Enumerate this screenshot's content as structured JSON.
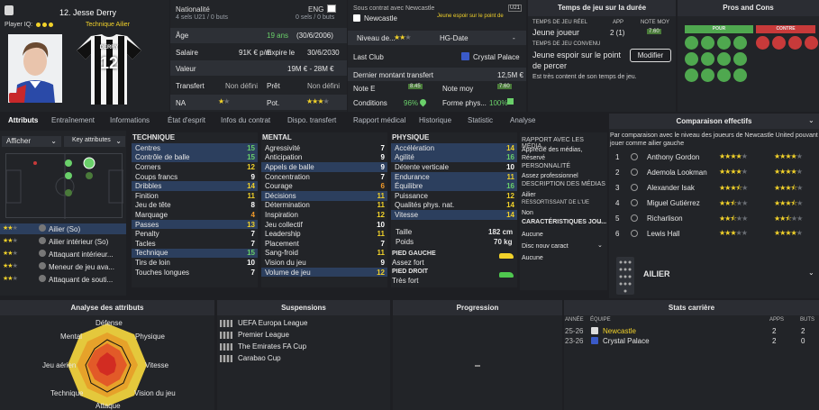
{
  "player": {
    "number_name": "12. Jesse Derry",
    "role_label": "Technique Ailier",
    "iq_label": "Player IQ:",
    "shirt_name": "DERRY",
    "shirt_number": "12"
  },
  "info": {
    "nationality_label": "Nationalité",
    "nationality_value": "ENG",
    "caps": "4 sels U21 / 0 buts",
    "caps2": "0 sels / 0 buts",
    "age_label": "Âge",
    "age_value": "19 ans",
    "dob": "(30/6/2006)",
    "salary_label": "Salaire",
    "salary_value": "91K € p/m",
    "expiry_label": "Expire le",
    "expiry_value": "30/6/2030",
    "value_label": "Valeur",
    "value_value": "19M € - 28M €",
    "transfer_label": "Transfert",
    "transfer_value": "Non défini",
    "loan_label": "Prêt",
    "loan_value": "Non défini",
    "na_label": "NA",
    "pot_label": "Pot."
  },
  "contract": {
    "status": "Sous contrat avec Newcastle",
    "club": "Newcastle",
    "promise": "Jeune espoir sur le point de",
    "badge": "U21",
    "level_label": "Niveau de...",
    "hg_label": "HG-Date",
    "hg_value": "-",
    "lastclub_label": "Last Club",
    "lastclub_value": "Crystal Palace",
    "lasttransfer_label": "Dernier montant transfert",
    "lasttransfer_value": "12,5M €",
    "note_label": "Note E",
    "note_value": "8.45",
    "notemoy_label": "Note moy",
    "notemoy_value": "7.60",
    "conditions_label": "Conditions",
    "conditions_value": "96%",
    "forme_label": "Forme phys...",
    "forme_value": "100%"
  },
  "playtime": {
    "title": "Temps de jeu sur la durée",
    "real_label": "TEMPS DE JEU RÉEL",
    "real_value": "Jeune joueur",
    "app_label": "APP",
    "app_value": "2 (1)",
    "note_label": "NOTE MOY",
    "note_value": "7.60",
    "agreed_label": "TEMPS DE JEU CONVENU",
    "agreed_value": "Jeune espoir sur le point de percer",
    "modify_label": "Modifier",
    "satisfied": "Est très content de son temps de jeu."
  },
  "proscons": {
    "title": "Pros and Cons",
    "pour_label": "POUR",
    "contre_label": "CONTRE"
  },
  "tabs": [
    "Attributs",
    "Entraînement",
    "Informations",
    "État d'esprit",
    "Infos du contrat",
    "Dispo. transfert",
    "Rapport médical",
    "Historique",
    "Statistic",
    "Analyse"
  ],
  "left": {
    "afficher": "Afficher",
    "keyattr": "Key attributes",
    "roles": [
      {
        "name": "Ailier (So)",
        "stars": 2.5
      },
      {
        "name": "Ailier intérieur (So)",
        "stars": 2.5
      },
      {
        "name": "Attaquant intérieur...",
        "stars": 2.5
      },
      {
        "name": "Meneur de jeu ava...",
        "stars": 2.5
      },
      {
        "name": "Attaquant de souti...",
        "stars": 2
      }
    ]
  },
  "technique": {
    "title": "TECHNIQUE",
    "items": [
      {
        "name": "Centres",
        "value": "15",
        "hl": true
      },
      {
        "name": "Contrôle de balle",
        "value": "15",
        "hl": true
      },
      {
        "name": "Corners",
        "value": "12",
        "hl": false
      },
      {
        "name": "Coups francs",
        "value": "9",
        "hl": false
      },
      {
        "name": "Dribbles",
        "value": "14",
        "hl": true
      },
      {
        "name": "Finition",
        "value": "11",
        "hl": false
      },
      {
        "name": "Jeu de tête",
        "value": "8",
        "hl": false
      },
      {
        "name": "Marquage",
        "value": "4",
        "hl": false
      },
      {
        "name": "Passes",
        "value": "13",
        "hl": true
      },
      {
        "name": "Penalty",
        "value": "7",
        "hl": false
      },
      {
        "name": "Tacles",
        "value": "7",
        "hl": false
      },
      {
        "name": "Technique",
        "value": "15",
        "hl": true
      },
      {
        "name": "Tirs de loin",
        "value": "10",
        "hl": false
      },
      {
        "name": "Touches longues",
        "value": "7",
        "hl": false
      }
    ]
  },
  "mental": {
    "title": "MENTAL",
    "items": [
      {
        "name": "Agressivité",
        "value": "7",
        "hl": false
      },
      {
        "name": "Anticipation",
        "value": "9",
        "hl": false
      },
      {
        "name": "Appels de balle",
        "value": "9",
        "hl": true
      },
      {
        "name": "Concentration",
        "value": "7",
        "hl": false
      },
      {
        "name": "Courage",
        "value": "6",
        "hl": false
      },
      {
        "name": "Décisions",
        "value": "11",
        "hl": true
      },
      {
        "name": "Détermination",
        "value": "11",
        "hl": false
      },
      {
        "name": "Inspiration",
        "value": "12",
        "hl": false
      },
      {
        "name": "Jeu collectif",
        "value": "10",
        "hl": false
      },
      {
        "name": "Leadership",
        "value": "11",
        "hl": false
      },
      {
        "name": "Placement",
        "value": "7",
        "hl": false
      },
      {
        "name": "Sang-froid",
        "value": "11",
        "hl": false
      },
      {
        "name": "Vision du jeu",
        "value": "9",
        "hl": false
      },
      {
        "name": "Volume de jeu",
        "value": "12",
        "hl": true
      }
    ]
  },
  "physique": {
    "title": "PHYSIQUE",
    "items": [
      {
        "name": "Accélération",
        "value": "14",
        "hl": true
      },
      {
        "name": "Agilité",
        "value": "16",
        "hl": true
      },
      {
        "name": "Détente verticale",
        "value": "10",
        "hl": false
      },
      {
        "name": "Endurance",
        "value": "11",
        "hl": true
      },
      {
        "name": "Équilibre",
        "value": "16",
        "hl": true
      },
      {
        "name": "Puissance",
        "value": "12",
        "hl": false
      },
      {
        "name": "Qualités phys. nat.",
        "value": "14",
        "hl": false
      },
      {
        "name": "Vitesse",
        "value": "14",
        "hl": true
      }
    ],
    "taille_label": "Taille",
    "taille_value": "182 cm",
    "poids_label": "Poids",
    "poids_value": "70 kg",
    "piedg_label": "PIED GAUCHE",
    "piedg_value": "Assez fort",
    "piedd_label": "PIED DROIT",
    "piedd_value": "Très fort"
  },
  "media": {
    "rapport_title": "RAPPORT AVEC LES MÉDIA...",
    "rapport_value": "Apprécié des médias, Réservé",
    "perso_title": "PERSONNALITÉ",
    "perso_value": "Assez professionnel",
    "desc_title": "DESCRIPTION DES MÉDIAS",
    "desc_value": "Ailier",
    "ress_title": "RESSORTISSANT DE L'UE",
    "ress_value": "Non",
    "carac_title": "CARACTÉRISTIQUES JOU...",
    "carac_value": "Aucune",
    "disc_title": "Disc nouv caract",
    "disc_value": "Aucune"
  },
  "comparison": {
    "title": "Comparaison effectifs",
    "subtitle": "Par comparaison avec le niveau des joueurs de Newcastle United pouvant jouer comme ailier gauche",
    "rows": [
      {
        "rank": "1",
        "name": "Anthony Gordon",
        "cur": 4,
        "pot": 4
      },
      {
        "rank": "2",
        "name": "Ademola Lookman",
        "cur": 4,
        "pot": 4
      },
      {
        "rank": "3",
        "name": "Alexander Isak",
        "cur": 3.5,
        "pot": 3.5
      },
      {
        "rank": "4",
        "name": "Miguel Gutiérrez",
        "cur": 2.5,
        "pot": 3.5
      },
      {
        "rank": "5",
        "name": "Richarlison",
        "cur": 2.5,
        "pot": 2.5
      },
      {
        "rank": "6",
        "name": "Lewis Hall",
        "cur": 3,
        "pot": 4
      }
    ],
    "pos_label": "AILIER"
  },
  "analysis": {
    "title": "Analyse des attributs",
    "labels": {
      "defense": "Défense",
      "physique": "Physique",
      "vitesse": "Vitesse",
      "vision": "Vision du jeu",
      "attaque": "Attaque",
      "technique": "Technique",
      "jeuaerien": "Jeu aérien",
      "mental": "Mental"
    }
  },
  "suspensions": {
    "title": "Suspensions",
    "items": [
      "UEFA Europa League",
      "Premier League",
      "The Emirates FA Cup",
      "Carabao Cup"
    ]
  },
  "progression": {
    "title": "Progression"
  },
  "career": {
    "title": "Stats carrière",
    "h_year": "ANNÉE",
    "h_team": "ÉQUIPE",
    "h_apps": "APPS",
    "h_goals": "BUTS",
    "rows": [
      {
        "year": "25-26",
        "team": "Newcastle",
        "apps": "2",
        "goals": "2"
      },
      {
        "year": "23-26",
        "team": "Crystal Palace",
        "apps": "2",
        "goals": "0"
      }
    ]
  },
  "colors": {
    "accent": "#f2d22a",
    "green": "#6ad06a",
    "highlight": "#2c3f5e",
    "pour": "#4fa84f",
    "contre": "#c83a3a"
  }
}
